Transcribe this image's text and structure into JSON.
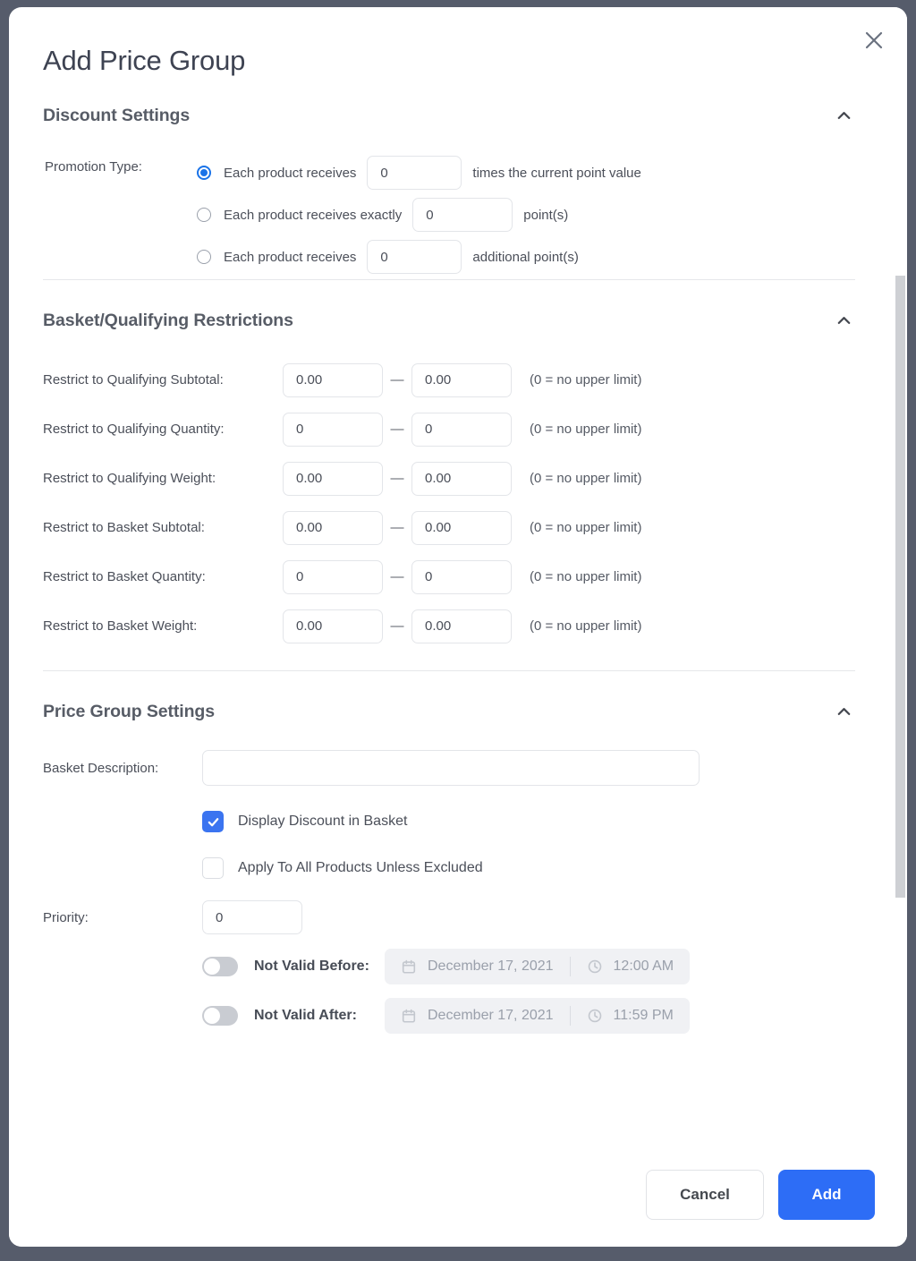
{
  "modal": {
    "title": "Add Price Group",
    "close_icon": "close-icon"
  },
  "sections": {
    "discount": {
      "title": "Discount Settings",
      "chevron_icon": "chevron-up-icon",
      "promotion_type_label": "Promotion Type:",
      "options": [
        {
          "selected": true,
          "prefix": "Each product receives",
          "value": "0",
          "suffix": "times the current point value"
        },
        {
          "selected": false,
          "prefix": "Each product receives exactly",
          "value": "0",
          "suffix": "point(s)"
        },
        {
          "selected": false,
          "prefix": "Each product receives",
          "value": "0",
          "suffix": "additional point(s)"
        }
      ]
    },
    "restrictions": {
      "title": "Basket/Qualifying Restrictions",
      "chevron_icon": "chevron-up-icon",
      "dash": "—",
      "note": "(0 = no upper limit)",
      "rows": [
        {
          "label": "Restrict to Qualifying Subtotal:",
          "min": "0.00",
          "max": "0.00"
        },
        {
          "label": "Restrict to Qualifying Quantity:",
          "min": "0",
          "max": "0"
        },
        {
          "label": "Restrict to Qualifying Weight:",
          "min": "0.00",
          "max": "0.00"
        },
        {
          "label": "Restrict to Basket Subtotal:",
          "min": "0.00",
          "max": "0.00"
        },
        {
          "label": "Restrict to Basket Quantity:",
          "min": "0",
          "max": "0"
        },
        {
          "label": "Restrict to Basket Weight:",
          "min": "0.00",
          "max": "0.00"
        }
      ]
    },
    "price_group": {
      "title": "Price Group Settings",
      "chevron_icon": "chevron-up-icon",
      "basket_description_label": "Basket Description:",
      "basket_description_value": "",
      "basket_description_placeholder": "",
      "checkboxes": [
        {
          "label": "Display Discount in Basket",
          "checked": true
        },
        {
          "label": "Apply To All Products Unless Excluded",
          "checked": false
        }
      ],
      "priority_label": "Priority:",
      "priority_value": "0",
      "date_rows": [
        {
          "label": "Not Valid Before:",
          "enabled": false,
          "date": "December 17, 2021",
          "time": "12:00 AM",
          "calendar_icon": "calendar-icon",
          "clock_icon": "clock-icon"
        },
        {
          "label": "Not Valid After:",
          "enabled": false,
          "date": "December 17, 2021",
          "time": "11:59 PM",
          "calendar_icon": "calendar-icon",
          "clock_icon": "clock-icon"
        }
      ]
    }
  },
  "footer": {
    "cancel_label": "Cancel",
    "add_label": "Add"
  },
  "colors": {
    "accent_blue": "#2d6df6",
    "radio_blue": "#1a73e8",
    "checkbox_blue": "#3b74f0",
    "backdrop": "#565c6b"
  }
}
